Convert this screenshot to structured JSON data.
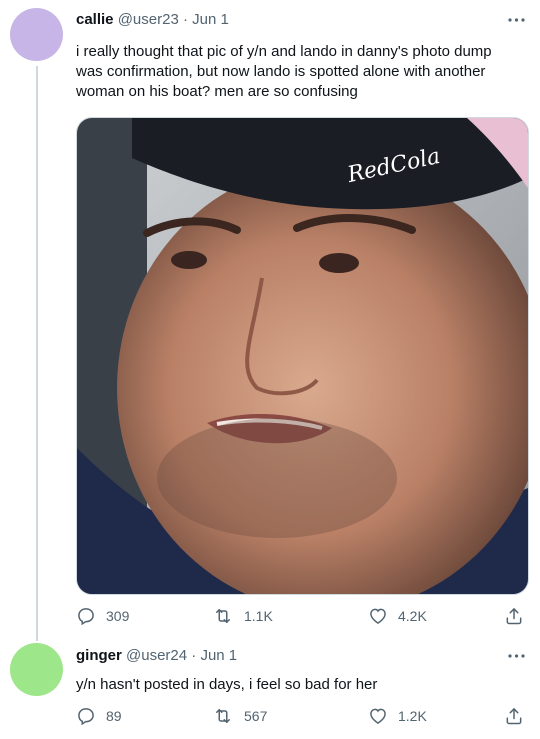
{
  "tweets": [
    {
      "name": "callie",
      "handle": "@user23",
      "separator": "·",
      "date": "Jun 1",
      "avatar_color": "#c6b5e6",
      "text": "i really thought that pic of y/n and lando in danny's photo dump was confirmation, but now lando is spotted alone with another woman on his boat? men are so confusing",
      "media": {
        "cap_text": "RedCola"
      },
      "replies": "309",
      "retweets": "1.1K",
      "likes": "4.2K"
    },
    {
      "name": "ginger",
      "handle": "@user24",
      "separator": "·",
      "date": "Jun 1",
      "avatar_color": "#9ee68a",
      "text": "y/n hasn't posted in days, i feel so bad for her",
      "replies": "89",
      "retweets": "567",
      "likes": "1.2K"
    }
  ],
  "icons": {
    "more": "more-dots-icon",
    "reply": "reply-icon",
    "retweet": "retweet-icon",
    "like": "heart-icon",
    "share": "share-icon"
  },
  "colors": {
    "text": "#0f1419",
    "secondary": "#536471",
    "line": "#cfd9de"
  }
}
